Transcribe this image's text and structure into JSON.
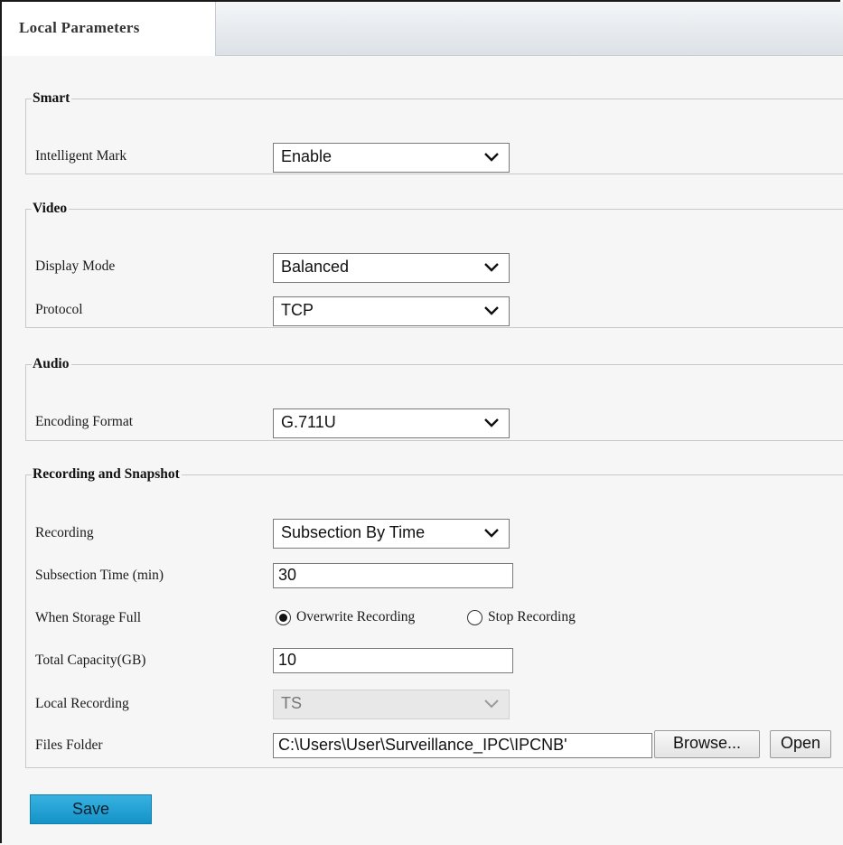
{
  "tab": {
    "title": "Local Parameters"
  },
  "smart": {
    "legend": "Smart",
    "intelligent_mark": {
      "label": "Intelligent Mark",
      "value": "Enable"
    }
  },
  "video": {
    "legend": "Video",
    "display_mode": {
      "label": "Display Mode",
      "value": "Balanced"
    },
    "protocol": {
      "label": "Protocol",
      "value": "TCP"
    }
  },
  "audio": {
    "legend": "Audio",
    "encoding_format": {
      "label": "Encoding Format",
      "value": "G.711U"
    }
  },
  "recording": {
    "legend": "Recording and Snapshot",
    "recording": {
      "label": "Recording",
      "value": "Subsection By Time"
    },
    "subsection_time": {
      "label": "Subsection Time (min)",
      "value": "30"
    },
    "storage_full": {
      "label": "When Storage Full",
      "options": [
        "Overwrite Recording",
        "Stop Recording"
      ],
      "selected": "Overwrite Recording"
    },
    "total_capacity": {
      "label": "Total Capacity(GB)",
      "value": "10"
    },
    "local_recording": {
      "label": "Local Recording",
      "value": "TS"
    },
    "files_folder": {
      "label": "Files Folder",
      "value": "C:\\Users\\User\\Surveillance_IPC\\IPCNB'"
    },
    "browse_label": "Browse...",
    "open_label": "Open"
  },
  "save_label": "Save",
  "colors": {
    "save_button": "#1a9bd0",
    "panel_bg": "#f6f6f6",
    "tab_bg": "#ffffff"
  },
  "icons": {
    "dropdown": "chevron-down-icon"
  }
}
